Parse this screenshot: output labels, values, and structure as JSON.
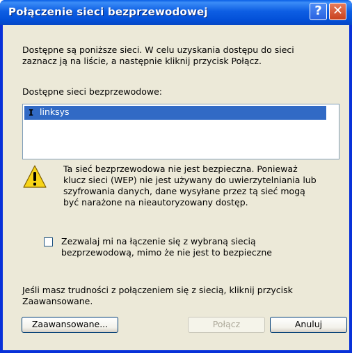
{
  "window": {
    "title": "Połączenie sieci bezprzewodowej",
    "help_glyph": "?",
    "close_glyph": "✕"
  },
  "intro": {
    "line1": "Dostępne są poniższe sieci. W celu uzyskania dostępu do sieci",
    "line2": "zaznacz ją na liście, a następnie kliknij przycisk Połącz."
  },
  "networks": {
    "label": "Dostępne sieci bezprzewodowe:",
    "items": [
      {
        "name": "linksys",
        "selected": true,
        "icon": "antenna-icon"
      }
    ]
  },
  "warning": {
    "icon": "warning-icon",
    "lines": [
      "Ta sieć bezprzewodowa nie jest bezpieczna. Ponieważ",
      "klucz sieci (WEP) nie jest używany do uwierzytelniania lub",
      "szyfrowania danych, dane wysyłane przez tą sieć mogą",
      "być narażone na nieautoryzowany dostęp."
    ]
  },
  "allow_checkbox": {
    "checked": false,
    "line1": "Zezwalaj mi na łączenie się z wybraną siecią",
    "line2": "bezprzewodową, mimo że nie jest to bezpieczne"
  },
  "help_text": {
    "line1": "Jeśli masz trudności z połączeniem się z siecią, kliknij przycisk",
    "line2": "Zaawansowane."
  },
  "buttons": {
    "advanced": "Zaawansowane...",
    "connect": "Połącz",
    "connect_enabled": false,
    "cancel": "Anuluj"
  },
  "colors": {
    "titlebar": "#0350d8",
    "selection": "#316ac5",
    "dialog_bg": "#ece9d8"
  }
}
